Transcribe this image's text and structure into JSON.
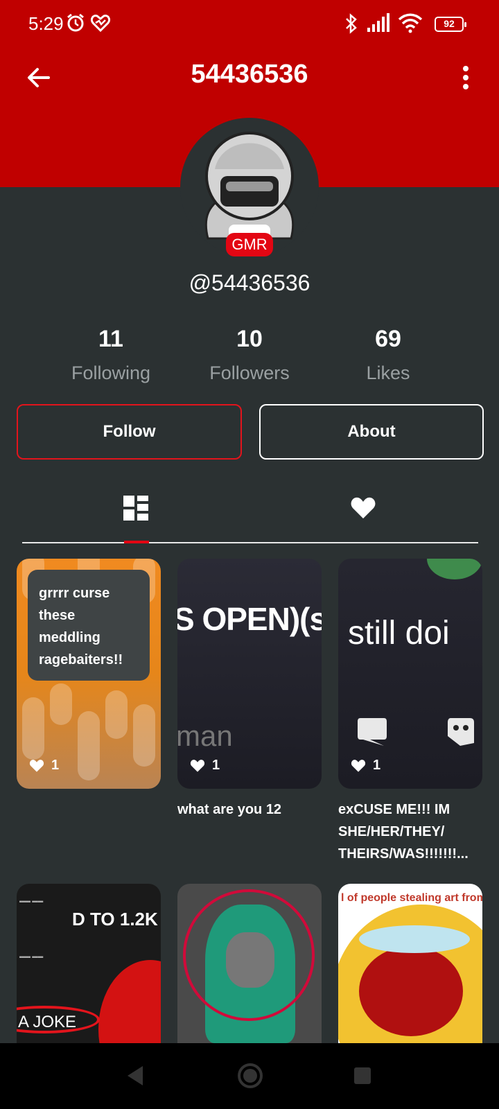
{
  "status_bar": {
    "time": "5:29",
    "battery": "92"
  },
  "header": {
    "title": "54436536"
  },
  "profile": {
    "badge": "GMR",
    "handle": "@54436536"
  },
  "stats": [
    {
      "value": "11",
      "label": "Following"
    },
    {
      "value": "10",
      "label": "Followers"
    },
    {
      "value": "69",
      "label": "Likes"
    }
  ],
  "actions": {
    "follow_label": "Follow",
    "about_label": "About"
  },
  "tabs": [
    {
      "icon": "grid-icon",
      "active": true
    },
    {
      "icon": "heart-icon",
      "active": false
    }
  ],
  "posts": [
    {
      "thumb_text": "grrrr curse these meddling ragebaiters!!",
      "likes": "1",
      "caption": ""
    },
    {
      "thumb_text": "S OPEN)(s",
      "thumb_text_2": "man",
      "likes": "1",
      "caption": "what are you 12"
    },
    {
      "thumb_text": "still doi",
      "likes": "1",
      "caption_line1": "exCUSE ME!!! IM",
      "caption_line2": "SHE/HER/THEY/",
      "caption_line3": "THEIRS/WAS!!!!!!!..."
    },
    {
      "thumb_text": "D TO 1.2K",
      "thumb_text_2": "A JOKE"
    },
    {},
    {
      "thumb_text": "l of people stealing art from"
    }
  ],
  "colors": {
    "brand_red": "#c00000",
    "accent_red": "#e30613",
    "background": "#2b3132"
  }
}
